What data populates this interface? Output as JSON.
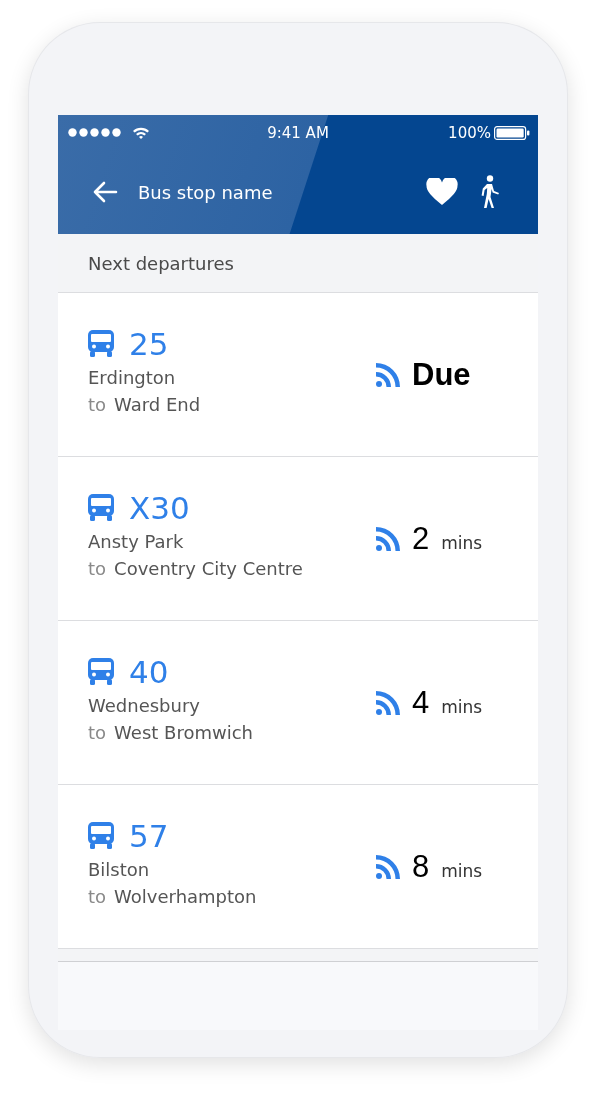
{
  "status_bar": {
    "time": "9:41 AM",
    "battery": "100%"
  },
  "header": {
    "title": "Bus stop name"
  },
  "section": {
    "title": "Next departures"
  },
  "departures": [
    {
      "route": "25",
      "origin": "Erdington",
      "to_label": "to",
      "destination": "Ward End",
      "kind": "due",
      "time": "Due"
    },
    {
      "route": "X30",
      "origin": "Ansty Park",
      "to_label": "to",
      "destination": "Coventry City Centre",
      "kind": "minutes",
      "time": "2",
      "unit": "mins"
    },
    {
      "route": "40",
      "origin": "Wednesbury",
      "to_label": "to",
      "destination": "West Bromwich",
      "kind": "minutes",
      "time": "4",
      "unit": "mins"
    },
    {
      "route": "57",
      "origin": "Bilston",
      "to_label": "to",
      "destination": "Wolverhampton",
      "kind": "minutes",
      "time": "8",
      "unit": "mins"
    }
  ]
}
